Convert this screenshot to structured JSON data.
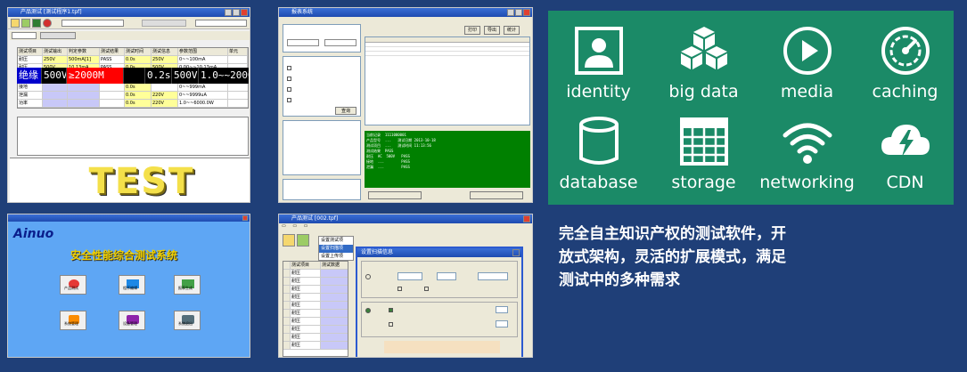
{
  "screenshots": {
    "s1": {
      "title": "产品测试 [测试程序1.tpf]",
      "test_banner": "TEST",
      "grid_headers": [
        "测试项目",
        "测试输出",
        "判定参数",
        "测试结果",
        "测试时间",
        "测试信息",
        "参数范围",
        "单元"
      ],
      "grid_rows": [
        [
          "耐压",
          "250V",
          "500mA[1]",
          "PASS",
          "0.0s",
          "250V",
          "0~~100mA",
          ""
        ],
        [
          "耐压",
          "500V",
          "10.13mA",
          "PASS",
          "0.0s",
          "500V",
          "0.00~~10.13mA",
          ""
        ]
      ],
      "highlight_row": [
        "绝缘",
        "500V",
        "≥2000M",
        "",
        "0.2s",
        "500V",
        "1.0~~2000.",
        ""
      ],
      "extra_rows": [
        [
          "接地",
          "",
          "",
          "",
          "0.0s",
          "",
          "0~~999mA",
          ""
        ],
        [
          "泄漏",
          "",
          "",
          "",
          "0.0s",
          "220V",
          "0~~9999uA",
          ""
        ],
        [
          "功率",
          "",
          "",
          "",
          "0.0s",
          "220V",
          "1.0~~6000.0W",
          ""
        ]
      ],
      "colors": {
        "pass": "#ffff00",
        "fail": "#ff0000",
        "hl_text": "#ffffff",
        "hl_green": "#00ff00",
        "hl_yellow": "#ffff00"
      }
    },
    "s2": {
      "title": "报表系统",
      "green_log": "当前记录  1111000001\n产品型号  ...   测试日期 2013-10-18\n测试项目  ...   测试时间 11:13:56\n测试结果  PASS\n耐压  AC  500V   PASS\n接地  ...        PASS\n泄漏  ...        PASS",
      "buttons": [
        "查询",
        "打印",
        "导出",
        "统计"
      ]
    },
    "s3": {
      "logo": "Ainuo",
      "title": "安全性能综合测试系统",
      "buttons": [
        {
          "label": "产品测试"
        },
        {
          "label": "程序编辑"
        },
        {
          "label": "报表生成"
        },
        {
          "label": "系统管理"
        },
        {
          "label": "设备管理"
        },
        {
          "label": "系统退出"
        }
      ]
    },
    "s4": {
      "title": "产品测试 [002.tpf]",
      "menu_items": [
        "设置测试项",
        "设置扫描项",
        "设置上传项"
      ],
      "dialog_title": "设置扫描信息",
      "rows": [
        "耐压",
        "耐压",
        "耐压",
        "耐压",
        "耐压",
        "耐压",
        "耐压",
        "耐压",
        "耐压",
        "耐压"
      ],
      "col_headers": [
        "测试项目",
        "测试数据"
      ]
    }
  },
  "features": [
    {
      "label": "identity",
      "icon": "identity-icon"
    },
    {
      "label": "big data",
      "icon": "big-data-icon"
    },
    {
      "label": "media",
      "icon": "media-icon"
    },
    {
      "label": "caching",
      "icon": "caching-icon"
    },
    {
      "label": "database",
      "icon": "database-icon"
    },
    {
      "label": "storage",
      "icon": "storage-icon"
    },
    {
      "label": "networking",
      "icon": "networking-icon"
    },
    {
      "label": "CDN",
      "icon": "cdn-icon"
    }
  ],
  "description": "完全自主知识产权的测试软件，开放式架构，灵活的扩展模式，满足测试中的多种需求",
  "colors": {
    "background": "#1f3f78",
    "feature_panel": "#1b8a67",
    "text": "#ffffff"
  }
}
